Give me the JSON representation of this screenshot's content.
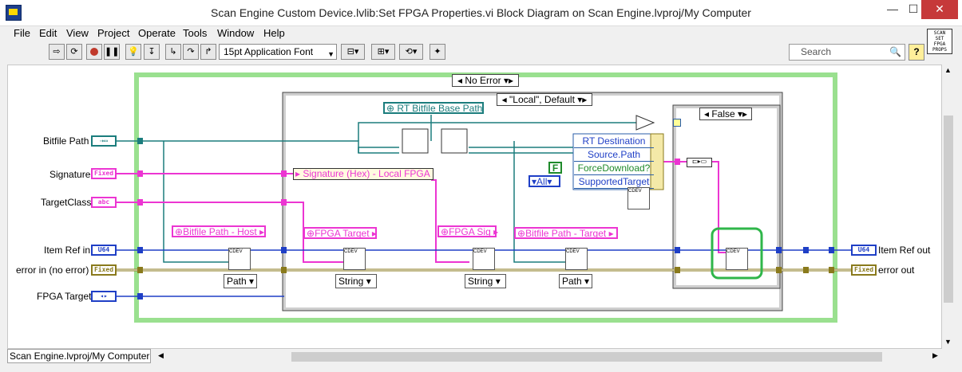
{
  "window": {
    "title": "Scan Engine Custom Device.lvlib:Set FPGA Properties.vi Block Diagram on Scan Engine.lvproj/My Computer",
    "min_label": "—",
    "max_label": "☐",
    "close_label": "✕"
  },
  "menu": [
    "File",
    "Edit",
    "View",
    "Project",
    "Operate",
    "Tools",
    "Window",
    "Help"
  ],
  "toolbar": {
    "font_select": "15pt Application Font",
    "search_placeholder": "Search",
    "help_label": "?",
    "vi_icon_lines": [
      "SCAN",
      "SET",
      "FPGA",
      "PROPS"
    ]
  },
  "diagram": {
    "controls": {
      "bitfile_path": "Bitfile Path",
      "signature": "Signature",
      "target_class": "TargetClass",
      "item_ref_in": "Item Ref in",
      "error_in": "error in (no error)",
      "fpga_target": "FPGA Target"
    },
    "terminal_text": {
      "signature": "Fixed",
      "target_class": "abc",
      "item_ref_in": "U64",
      "error_in": "Fixed",
      "item_ref_out": "U64",
      "error_out": "Fixed"
    },
    "indicators": {
      "item_ref_out": "Item Ref out",
      "error_out": "error out"
    },
    "case_structures": {
      "outer": "No Error",
      "middle": "\"Local\", Default",
      "inner": "False"
    },
    "constants": {
      "rt_bitfile_base_path": "RT Bitfile Base Path",
      "signature_hex": "Signature (Hex) - Local FPGA",
      "bitfile_path_host": "Bitfile Path - Host",
      "fpga_target": "FPGA Target",
      "fpga_sig": "FPGA Sig",
      "bitfile_path_target": "Bitfile Path - Target",
      "false_const": "F",
      "all_enum": "All"
    },
    "property_node": [
      "RT Destination",
      "Source.Path",
      "ForceDownload?",
      "SupportedTarget"
    ],
    "type_dropdowns": [
      "Path",
      "String",
      "String",
      "Path"
    ],
    "cdev_label": "CDEV"
  },
  "status": {
    "project_path": "Scan Engine.lvproj/My Computer"
  },
  "colors": {
    "path_wire": "#1b7d7d",
    "string_wire": "#ec35d2",
    "numeric_wire": "#1f3fc6",
    "error_wire": "#8a7a1c",
    "case_border": "#9ae08f",
    "highlight": "#2fb64a"
  }
}
